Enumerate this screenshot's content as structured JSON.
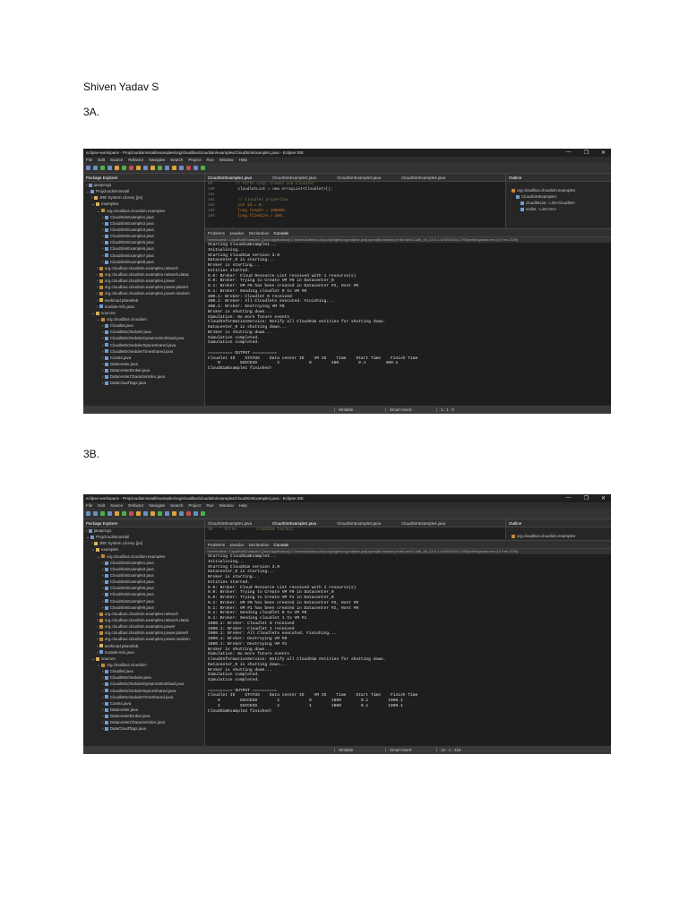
{
  "author": "Shiven Yadav S",
  "sections": [
    {
      "label": "3A.",
      "ide": {
        "title": "eclipse-workspace - Projcloudsiminstall/examples/org/cloudbus/cloudsim/examples/CloudSimExample1.java - Eclipse IDE",
        "window_controls": [
          "—",
          "❐",
          "✕"
        ],
        "menu": [
          "File",
          "Edit",
          "Source",
          "Refactor",
          "Navigate",
          "Search",
          "Project",
          "Run",
          "Window",
          "Help"
        ],
        "explorer_title": "Package Explorer",
        "tree": [
          {
            "d": 0,
            "t": "javaprog1",
            "i": "prj"
          },
          {
            "d": 0,
            "t": "Projcloudsiminstall",
            "i": "prj"
          },
          {
            "d": 1,
            "t": "JRE System Library [jre]",
            "i": "fld"
          },
          {
            "d": 1,
            "t": "examples",
            "i": "fld"
          },
          {
            "d": 2,
            "t": "org.cloudbus.cloudsim.examples",
            "i": "pkg"
          },
          {
            "d": 3,
            "t": "CloudSimExample1.java"
          },
          {
            "d": 3,
            "t": "CloudSimExample2.java"
          },
          {
            "d": 3,
            "t": "CloudSimExample3.java"
          },
          {
            "d": 3,
            "t": "CloudSimExample4.java"
          },
          {
            "d": 3,
            "t": "CloudSimExample5.java"
          },
          {
            "d": 3,
            "t": "CloudSimExample6.java"
          },
          {
            "d": 3,
            "t": "CloudSimExample7.java"
          },
          {
            "d": 3,
            "t": "CloudSimExample8.java"
          },
          {
            "d": 2,
            "t": "org.cloudbus.cloudsim.examples.network",
            "i": "pkg"
          },
          {
            "d": 2,
            "t": "org.cloudbus.cloudsim.examples.network.datac",
            "i": "pkg"
          },
          {
            "d": 2,
            "t": "org.cloudbus.cloudsim.examples.power",
            "i": "pkg"
          },
          {
            "d": 2,
            "t": "org.cloudbus.cloudsim.examples.power.planetl",
            "i": "pkg"
          },
          {
            "d": 2,
            "t": "org.cloudbus.cloudsim.examples.power.random",
            "i": "pkg"
          },
          {
            "d": 2,
            "t": "workload.planetlab",
            "i": "fld"
          },
          {
            "d": 2,
            "t": "module-info.java"
          },
          {
            "d": 1,
            "t": "sources",
            "i": "fld"
          },
          {
            "d": 2,
            "t": "org.cloudbus.cloudsim",
            "i": "pkg"
          },
          {
            "d": 3,
            "t": "Cloudlet.java"
          },
          {
            "d": 3,
            "t": "CloudletScheduler.java"
          },
          {
            "d": 3,
            "t": "CloudletSchedulerDynamicWorkload.java"
          },
          {
            "d": 3,
            "t": "CloudletSchedulerSpaceShared.java"
          },
          {
            "d": 3,
            "t": "CloudletSchedulerTimeShared.java"
          },
          {
            "d": 3,
            "t": "Consts.java"
          },
          {
            "d": 3,
            "t": "Datacenter.java"
          },
          {
            "d": 3,
            "t": "DatacenterBroker.java"
          },
          {
            "d": 3,
            "t": "DatacenterCharacteristics.java"
          },
          {
            "d": 3,
            "t": "DataCloudTags.java"
          }
        ],
        "editor_tabs": [
          "CloudSimExample1.java",
          "CloudSimExample2.java",
          "CloudSimExample3.java",
          "CloudSimExample4.java"
        ],
        "active_tab": 0,
        "code": [
          {
            "n": "99",
            "c": "        // Fifth step: Create one Cloudlet",
            "k": "cm"
          },
          {
            "n": "100",
            "c": "        cloudletList = new ArrayList<Cloudlet>();",
            "k": ""
          },
          {
            "n": "101",
            "c": "",
            "k": ""
          },
          {
            "n": "102",
            "c": "        // Cloudlet properties",
            "k": "cm"
          },
          {
            "n": "103",
            "c": "        int id = 0;",
            "k": "kw"
          },
          {
            "n": "104",
            "c": "        long length = 400000;",
            "k": "kw"
          },
          {
            "n": "105",
            "c": "        long fileSize = 300;",
            "k": "kw"
          }
        ],
        "outline_title": "Outline",
        "outline": [
          "org.cloudbus.cloudsim.examples",
          "CloudSimExample1",
          "cloudletList : List<Cloudlet>",
          "vmlist : List<Vm>"
        ],
        "console_tabs": [
          "Problems",
          "Javadoc",
          "Declaration",
          "Console"
        ],
        "terminated": "<terminated> CloudSimExample1 [Java Application] C:\\Users\\Admin\\.p2\\pool\\plugins\\org.eclipse.justj.openjdk.hotspot.jre.full.win32.x86_64_23.0.1.v20241024-1700\\jre\\bin\\javaw.exe (10 Feb 2025)",
        "console": [
          "Starting CloudSimExample1...",
          "Initialising...",
          "Starting CloudSim version 3.0",
          "Datacenter_0 is starting...",
          "Broker is starting...",
          "Entities started.",
          "0.0: Broker: Cloud Resource List received with 1 resource(s)",
          "0.0: Broker: Trying to Create VM #0 in Datacenter_0",
          "0.1: Broker: VM #0 has been created in Datacenter #2, Host #0",
          "0.1: Broker: Sending cloudlet 0 to VM #0",
          "400.1: Broker: Cloudlet 0 received",
          "400.1: Broker: All Cloudlets executed. Finishing...",
          "400.1: Broker: Destroying VM #0",
          "Broker is shutting down...",
          "Simulation: No more future events",
          "CloudInformationService: Notify all CloudSim entities for shutting down.",
          "Datacenter_0 is shutting down...",
          "Broker is shutting down...",
          "Simulation completed.",
          "Simulation completed.",
          "",
          "========== OUTPUT ==========",
          "Cloudlet ID    STATUS    Data center ID    VM ID    Time    Start Time    Finish Time",
          "    0        SUCCESS        2            0        400        0.1        400.1",
          "CloudSimExample1 finished!"
        ],
        "status": [
          "Writable",
          "Smart Insert",
          "1 : 1 : 0"
        ]
      }
    },
    {
      "label": "3B.",
      "ide": {
        "title": "eclipse-workspace - Projcloudsiminstall/examples/org/cloudbus/cloudsim/examples/CloudSimExample2.java - Eclipse IDE",
        "window_controls": [
          "—",
          "❐",
          "✕"
        ],
        "menu": [
          "File",
          "Edit",
          "Source",
          "Refactor",
          "Navigate",
          "Search",
          "Project",
          "Run",
          "Window",
          "Help"
        ],
        "explorer_title": "Package Explorer",
        "tree": [
          {
            "d": 0,
            "t": "javaprog1",
            "i": "prj"
          },
          {
            "d": 0,
            "t": "Projcloudsiminstall",
            "i": "prj"
          },
          {
            "d": 1,
            "t": "JRE System Library [jre]",
            "i": "fld"
          },
          {
            "d": 1,
            "t": "examples",
            "i": "fld"
          },
          {
            "d": 2,
            "t": "org.cloudbus.cloudsim.examples",
            "i": "pkg"
          },
          {
            "d": 3,
            "t": "CloudSimExample1.java"
          },
          {
            "d": 3,
            "t": "CloudSimExample2.java"
          },
          {
            "d": 3,
            "t": "CloudSimExample3.java"
          },
          {
            "d": 3,
            "t": "CloudSimExample4.java"
          },
          {
            "d": 3,
            "t": "CloudSimExample5.java"
          },
          {
            "d": 3,
            "t": "CloudSimExample6.java"
          },
          {
            "d": 3,
            "t": "CloudSimExample7.java"
          },
          {
            "d": 3,
            "t": "CloudSimExample8.java"
          },
          {
            "d": 2,
            "t": "org.cloudbus.cloudsim.examples.network",
            "i": "pkg"
          },
          {
            "d": 2,
            "t": "org.cloudbus.cloudsim.examples.network.datac",
            "i": "pkg"
          },
          {
            "d": 2,
            "t": "org.cloudbus.cloudsim.examples.power",
            "i": "pkg"
          },
          {
            "d": 2,
            "t": "org.cloudbus.cloudsim.examples.power.planetl",
            "i": "pkg"
          },
          {
            "d": 2,
            "t": "org.cloudbus.cloudsim.examples.power.random",
            "i": "pkg"
          },
          {
            "d": 2,
            "t": "workload.planetlab",
            "i": "fld"
          },
          {
            "d": 2,
            "t": "module-info.java"
          },
          {
            "d": 1,
            "t": "sources",
            "i": "fld"
          },
          {
            "d": 2,
            "t": "org.cloudbus.cloudsim",
            "i": "pkg"
          },
          {
            "d": 3,
            "t": "Cloudlet.java"
          },
          {
            "d": 3,
            "t": "CloudletScheduler.java"
          },
          {
            "d": 3,
            "t": "CloudletSchedulerDynamicWorkload.java"
          },
          {
            "d": 3,
            "t": "CloudletSchedulerSpaceShared.java"
          },
          {
            "d": 3,
            "t": "CloudletSchedulerTimeShared.java"
          },
          {
            "d": 3,
            "t": "Consts.java"
          },
          {
            "d": 3,
            "t": "Datacenter.java"
          },
          {
            "d": 3,
            "t": "DatacenterBroker.java"
          },
          {
            "d": 3,
            "t": "DatacenterCharacteristics.java"
          },
          {
            "d": 3,
            "t": "DataCloudTags.java"
          }
        ],
        "editor_tabs": [
          "CloudSimExample1.java",
          "CloudSimExample2.java",
          "CloudSimExample3.java",
          "CloudSimExample4.java"
        ],
        "active_tab": 1,
        "code": [
          {
            "n": "20",
            "c": " * Title:        CloudSim Toolkit",
            "k": "cm"
          }
        ],
        "outline_title": "Outline",
        "outline": [
          "org.cloudbus.cloudsim.examples"
        ],
        "console_tabs": [
          "Problems",
          "Javadoc",
          "Declaration",
          "Console"
        ],
        "terminated": "<terminated> CloudSimExample2 [Java Application] C:\\Users\\Admin\\.p2\\pool\\plugins\\org.eclipse.justj.openjdk.hotspot.jre.full.win32.x86_64_23.0.1.v20241024-1700\\jre\\bin\\javaw.exe (10 Feb 2025)",
        "console": [
          "Starting CloudSimExample2...",
          "Initialising...",
          "Starting CloudSim version 3.0",
          "Datacenter_0 is starting...",
          "Broker is starting...",
          "Entities started.",
          "0.0: Broker: Cloud Resource List received with 1 resource(s)",
          "0.0: Broker: Trying to Create VM #0 in Datacenter_0",
          "0.0: Broker: Trying to Create VM #1 in Datacenter_0",
          "0.1: Broker: VM #0 has been created in Datacenter #2, Host #0",
          "0.1: Broker: VM #1 has been created in Datacenter #2, Host #0",
          "0.1: Broker: Sending cloudlet 0 to VM #0",
          "0.1: Broker: Sending cloudlet 1 to VM #1",
          "1000.1: Broker: Cloudlet 0 received",
          "1000.1: Broker: Cloudlet 1 received",
          "1000.1: Broker: All Cloudlets executed. Finishing...",
          "1000.1: Broker: Destroying VM #0",
          "1000.1: Broker: Destroying VM #1",
          "Broker is shutting down...",
          "Simulation: No more future events",
          "CloudInformationService: Notify all CloudSim entities for shutting down.",
          "Datacenter_0 is shutting down...",
          "Broker is shutting down...",
          "Simulation completed.",
          "Simulation completed.",
          "",
          "========== OUTPUT ==========",
          "Cloudlet ID    STATUS    Data center ID    VM ID    Time    Start Time    Finish Time",
          "    0        SUCCESS        2            0        1000        0.1        1000.1",
          "    1        SUCCESS        2            1        1000        0.1        1000.1",
          "CloudSimExample2 finished!"
        ],
        "status": [
          "Writable",
          "Smart Insert",
          "12 : 1 : 316"
        ]
      }
    }
  ]
}
